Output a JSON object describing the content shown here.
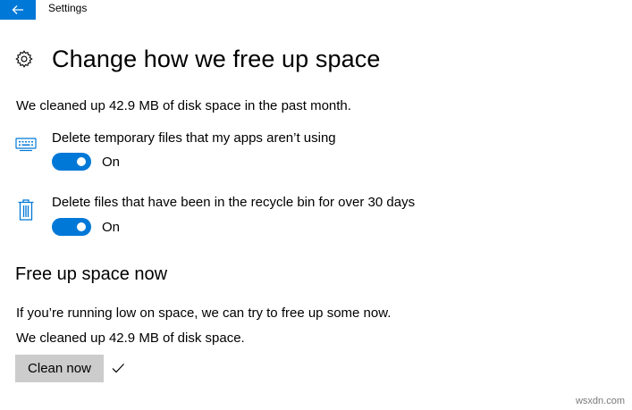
{
  "window": {
    "title": "Settings",
    "accent_color": "#0078d7"
  },
  "header": {
    "title": "Change how we free up space",
    "icon": "gear-icon"
  },
  "summary": {
    "past_month": "We cleaned up 42.9 MB of disk space in the past month."
  },
  "options": [
    {
      "label": "Delete temporary files that my apps aren’t using",
      "icon": "keyboard-icon",
      "toggle": true,
      "state_label": "On"
    },
    {
      "label": "Delete files that have been in the recycle bin for over 30 days",
      "icon": "trash-icon",
      "toggle": true,
      "state_label": "On"
    }
  ],
  "free_now": {
    "title": "Free up space now",
    "description": "If you’re running low on space, we can try to free up some now.",
    "result": "We cleaned up 42.9 MB of disk space.",
    "button_label": "Clean now",
    "status_icon": "checkmark-icon"
  },
  "watermark": "wsxdn.com"
}
